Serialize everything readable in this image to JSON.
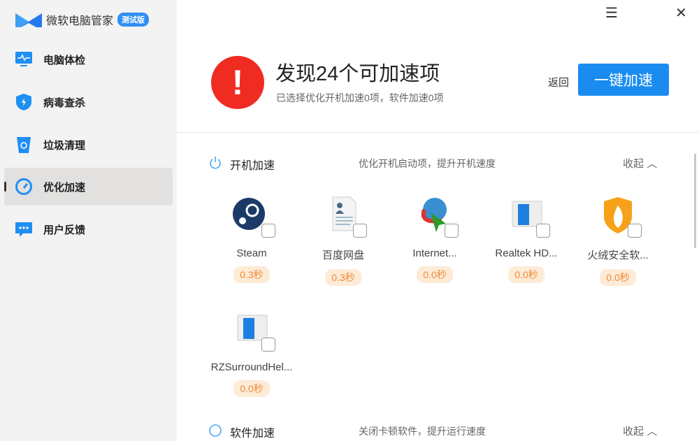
{
  "app": {
    "name": "微软电脑管家",
    "badge": "测试版"
  },
  "window": {
    "menu_icon": "☰",
    "close_icon": "✕"
  },
  "sidebar": {
    "items": [
      {
        "label": "电脑体检",
        "icon": "monitor-pulse-icon"
      },
      {
        "label": "病毒查杀",
        "icon": "shield-icon"
      },
      {
        "label": "垃圾清理",
        "icon": "trash-recycle-icon"
      },
      {
        "label": "优化加速",
        "icon": "speedometer-icon",
        "active": true
      },
      {
        "label": "用户反馈",
        "icon": "chat-icon"
      }
    ]
  },
  "header": {
    "alert_symbol": "!",
    "title": "发现24个可加速项",
    "subtitle": "已选择优化开机加速0项，软件加速0项",
    "back": "返回",
    "action": "一键加速"
  },
  "sections": [
    {
      "name": "开机加速",
      "desc": "优化开机启动项，提升开机速度",
      "collapse": "收起",
      "items": [
        {
          "name": "Steam",
          "time": "0.3秒"
        },
        {
          "name": "百度网盘",
          "time": "0.3秒"
        },
        {
          "name": "Internet...",
          "time": "0.0秒"
        },
        {
          "name": "Realtek HD...",
          "time": "0.0秒"
        },
        {
          "name": "火绒安全软...",
          "time": "0.0秒"
        },
        {
          "name": "RZSurroundHel...",
          "time": "0.0秒"
        }
      ]
    },
    {
      "name": "软件加速",
      "desc": "关闭卡顿软件，提升运行速度",
      "collapse": "收起"
    }
  ],
  "colors": {
    "accent": "#1a8cf0",
    "alert": "#f02b22",
    "pill_bg": "#fdebd6",
    "pill_text": "#f08a3a"
  }
}
